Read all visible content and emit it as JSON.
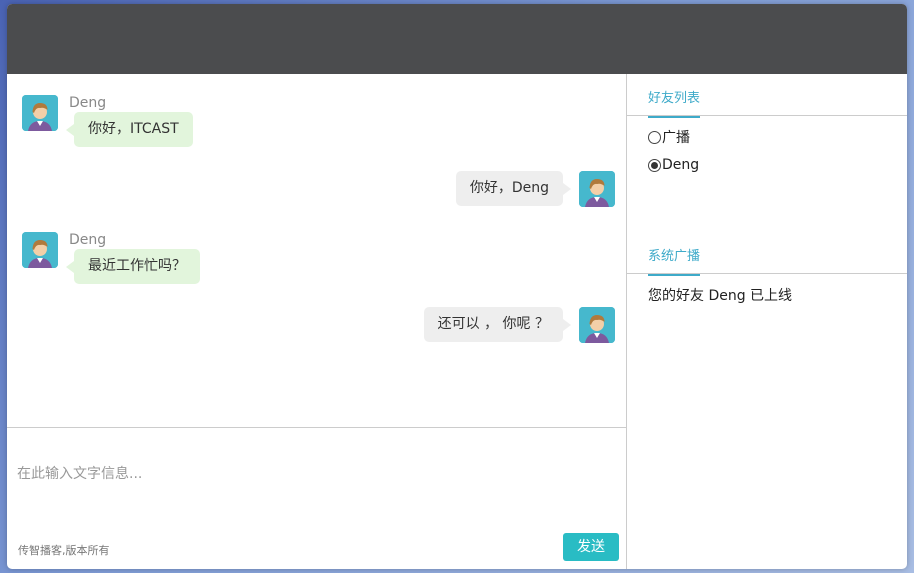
{
  "messages": [
    {
      "side": "left",
      "sender": "Deng",
      "text": "你好，ITCAST"
    },
    {
      "side": "right",
      "text": "你好，Deng"
    },
    {
      "side": "left",
      "sender": "Deng",
      "text": "最近工作忙吗？"
    },
    {
      "side": "right",
      "text": "还可以 ， 你呢 ？"
    }
  ],
  "composer": {
    "placeholder": "在此输入文字信息...",
    "copyright": "传智播客,版本所有",
    "send_label": "发送"
  },
  "friends_panel": {
    "title": "好友列表",
    "items": [
      {
        "label": "广播",
        "checked": false
      },
      {
        "label": "Deng",
        "checked": true
      }
    ]
  },
  "broadcast_panel": {
    "title": "系统广播",
    "messages": [
      "您的好友 Deng 已上线"
    ]
  },
  "colors": {
    "topbar": "#4b4c4e",
    "accent": "#3eaac9",
    "send_button": "#29bcc4",
    "left_bubble": "#e2f5dc",
    "right_bubble": "#eeeeee",
    "avatar_bg": "#46b8cd"
  },
  "icons": {
    "avatar": "user-avatar-icon"
  }
}
